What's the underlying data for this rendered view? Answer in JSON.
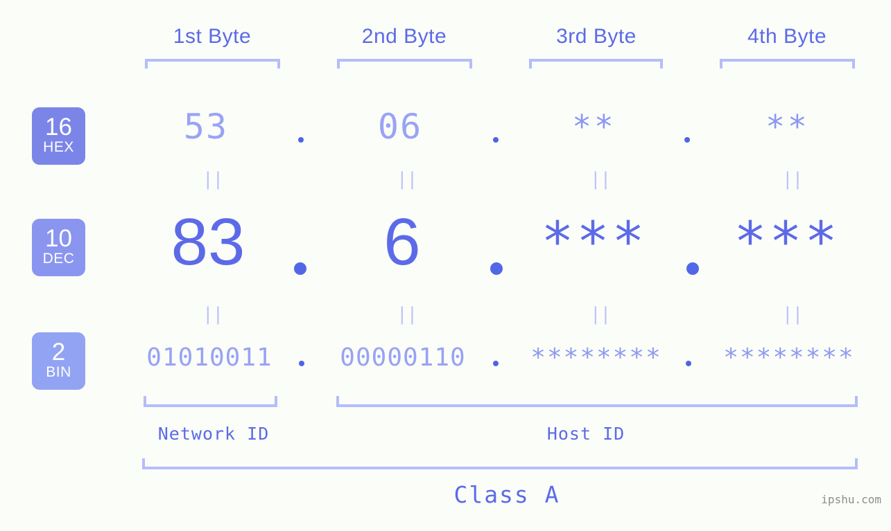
{
  "page": {
    "background_color": "#fbfdf8",
    "accent_color": "#5c6ae8",
    "accent_light_color": "#b4bdfb",
    "watermark": "ipshu.com"
  },
  "byte_headings": [
    {
      "label": "1st Byte"
    },
    {
      "label": "2nd Byte"
    },
    {
      "label": "3rd Byte"
    },
    {
      "label": "4th Byte"
    }
  ],
  "bases": [
    {
      "number": "16",
      "name": "HEX",
      "color": "#7b85e8"
    },
    {
      "number": "10",
      "name": "DEC",
      "color": "#8a95ef"
    },
    {
      "number": "2",
      "name": "BIN",
      "color": "#93a3f4"
    }
  ],
  "rows": {
    "hex": {
      "base_number": "16",
      "base_name": "HEX",
      "values": [
        "53",
        "06",
        "**",
        "**"
      ]
    },
    "dec": {
      "base_number": "10",
      "base_name": "DEC",
      "values": [
        "83",
        "6",
        "***",
        "***"
      ]
    },
    "bin": {
      "base_number": "2",
      "base_name": "BIN",
      "values": [
        "01010011",
        "00000110",
        "********",
        "********"
      ]
    }
  },
  "separators": {
    "dot": ".",
    "equals": "||"
  },
  "regions": [
    {
      "label": "Network ID"
    },
    {
      "label": "Host ID"
    }
  ],
  "class": {
    "label": "Class A"
  }
}
